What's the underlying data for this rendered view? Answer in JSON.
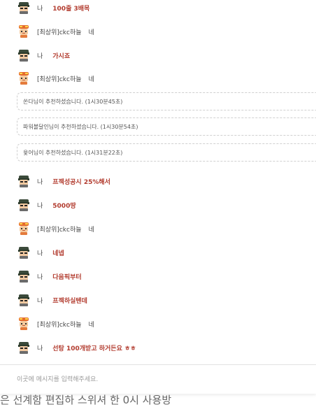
{
  "chat": {
    "messages": [
      {
        "type": "me",
        "name": "나",
        "text": "100줄 3배목"
      },
      {
        "type": "other",
        "name": "[최상위]ckc하늘",
        "text": "네"
      },
      {
        "type": "me",
        "name": "나",
        "text": "가시죠"
      },
      {
        "type": "other",
        "name": "[최상위]ckc하늘",
        "text": "네"
      },
      {
        "type": "notice",
        "text": "쏜다님이 추천하셨습니다. (1시30분45초)"
      },
      {
        "type": "notice",
        "text": "파워볼달인님이 추천하셨습니다. (1시30분54초)"
      },
      {
        "type": "notice",
        "text": "윷어님이 추천하셨습니다. (1시31분22초)"
      },
      {
        "type": "me",
        "name": "나",
        "text": "프젝성공시 25%해서"
      },
      {
        "type": "me",
        "name": "나",
        "text": "5000땅"
      },
      {
        "type": "other",
        "name": "[최상위]ckc하늘",
        "text": "네"
      },
      {
        "type": "me",
        "name": "나",
        "text": "네넵"
      },
      {
        "type": "me",
        "name": "나",
        "text": "다음픽부터"
      },
      {
        "type": "me",
        "name": "나",
        "text": "프젝하실텐데"
      },
      {
        "type": "other",
        "name": "[최상위]ckc하늘",
        "text": "네"
      },
      {
        "type": "me",
        "name": "나",
        "text": "선탕 100개받고 하거든요 ㅎㅎ"
      }
    ]
  },
  "input": {
    "placeholder": "이곳에 메시지를 입력해주세요."
  },
  "background_text": "은 선계함 편집하 스위셔 한 0시 사용방"
}
